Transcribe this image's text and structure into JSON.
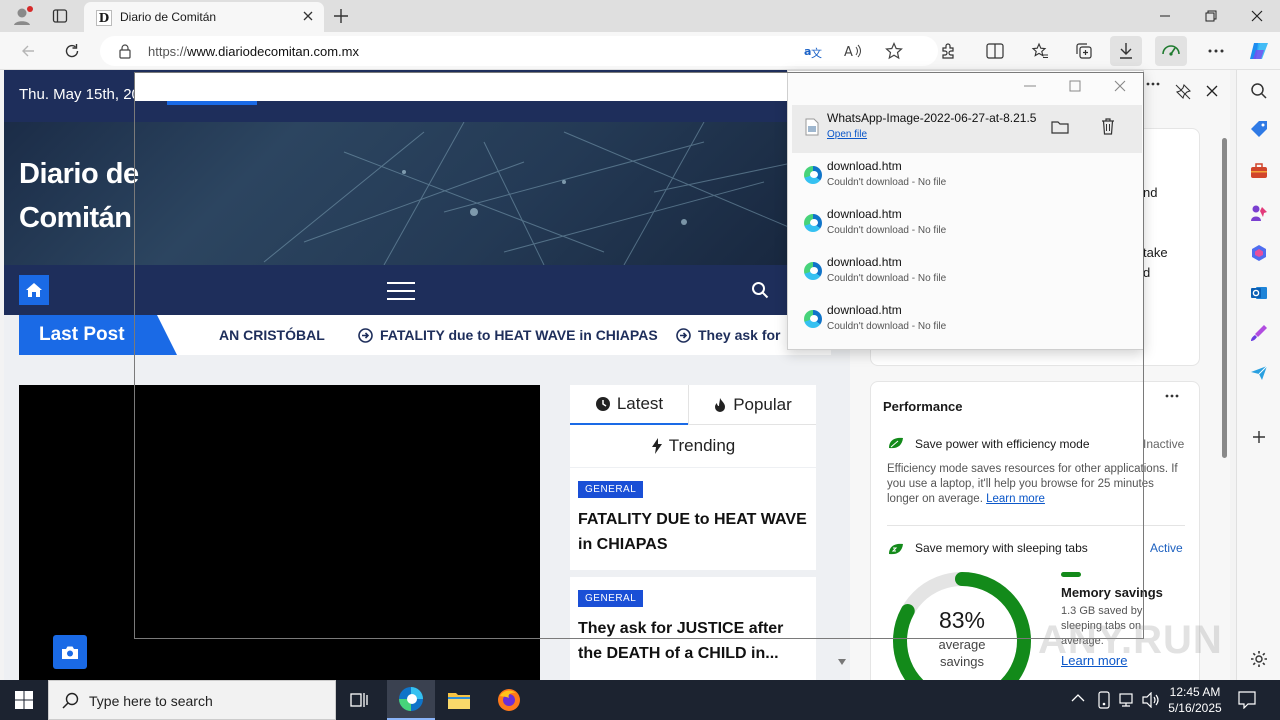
{
  "browser": {
    "tab_title": "Diario de Comitán",
    "tab_favicon": "D",
    "url_prefix": "https://",
    "url_host": "www.diariodecomitan.com.mx"
  },
  "site": {
    "date": "Thu. May 15th, 20",
    "brand_line1": "Diario de",
    "brand_line2": "Comitán",
    "last_post_label": "Last Post",
    "ticker": [
      "AN CRISTÓBAL",
      "FATALITY due to HEAT WAVE in CHIAPAS",
      "They ask for"
    ],
    "tabs": {
      "latest": "Latest",
      "popular": "Popular",
      "trending": "Trending"
    },
    "posts": [
      {
        "category": "GENERAL",
        "title": "FATALITY DUE to HEAT WAVE in CHIAPAS"
      },
      {
        "category": "GENERAL",
        "title": "They ask for JUSTICE after the DEATH of a CHILD in..."
      }
    ]
  },
  "downloads": {
    "items": [
      {
        "name": "WhatsApp-Image-2022-06-27-at-8.21.5",
        "action": "Open file"
      },
      {
        "name": "download.htm",
        "status": "Couldn't download - No file"
      },
      {
        "name": "download.htm",
        "status": "Couldn't download - No file"
      },
      {
        "name": "download.htm",
        "status": "Couldn't download - No file"
      },
      {
        "name": "download.htm",
        "status": "Couldn't download - No file"
      }
    ]
  },
  "sidebar": {
    "partial_text_1": "nd",
    "partial_text_2": "take",
    "partial_text_3": "d",
    "performance_title": "Performance",
    "efficiency_title": "Save power with efficiency mode",
    "efficiency_state": "Inactive",
    "efficiency_desc": "Efficiency mode saves resources for other applications. If you use a laptop, it'll help you browse for 25 minutes longer on average.",
    "learn_more": "Learn more",
    "sleeping_title": "Save memory with sleeping tabs",
    "sleeping_state": "Active",
    "gauge_percent": "83%",
    "gauge_value": 0.83,
    "gauge_line1": "average",
    "gauge_line2": "savings",
    "memory_title": "Memory savings",
    "memory_desc": "1.3 GB saved by sleeping tabs on average.",
    "learn_more_2": "Learn more"
  },
  "taskbar": {
    "search_placeholder": "Type here to search",
    "time": "12:45 AM",
    "date": "5/16/2025"
  },
  "watermark": "ANY.RUN",
  "colors": {
    "site_navy": "#1e2e5b",
    "site_blue": "#1a6ae6",
    "perf_green": "#138a1a",
    "link_blue": "#0b57c9"
  }
}
